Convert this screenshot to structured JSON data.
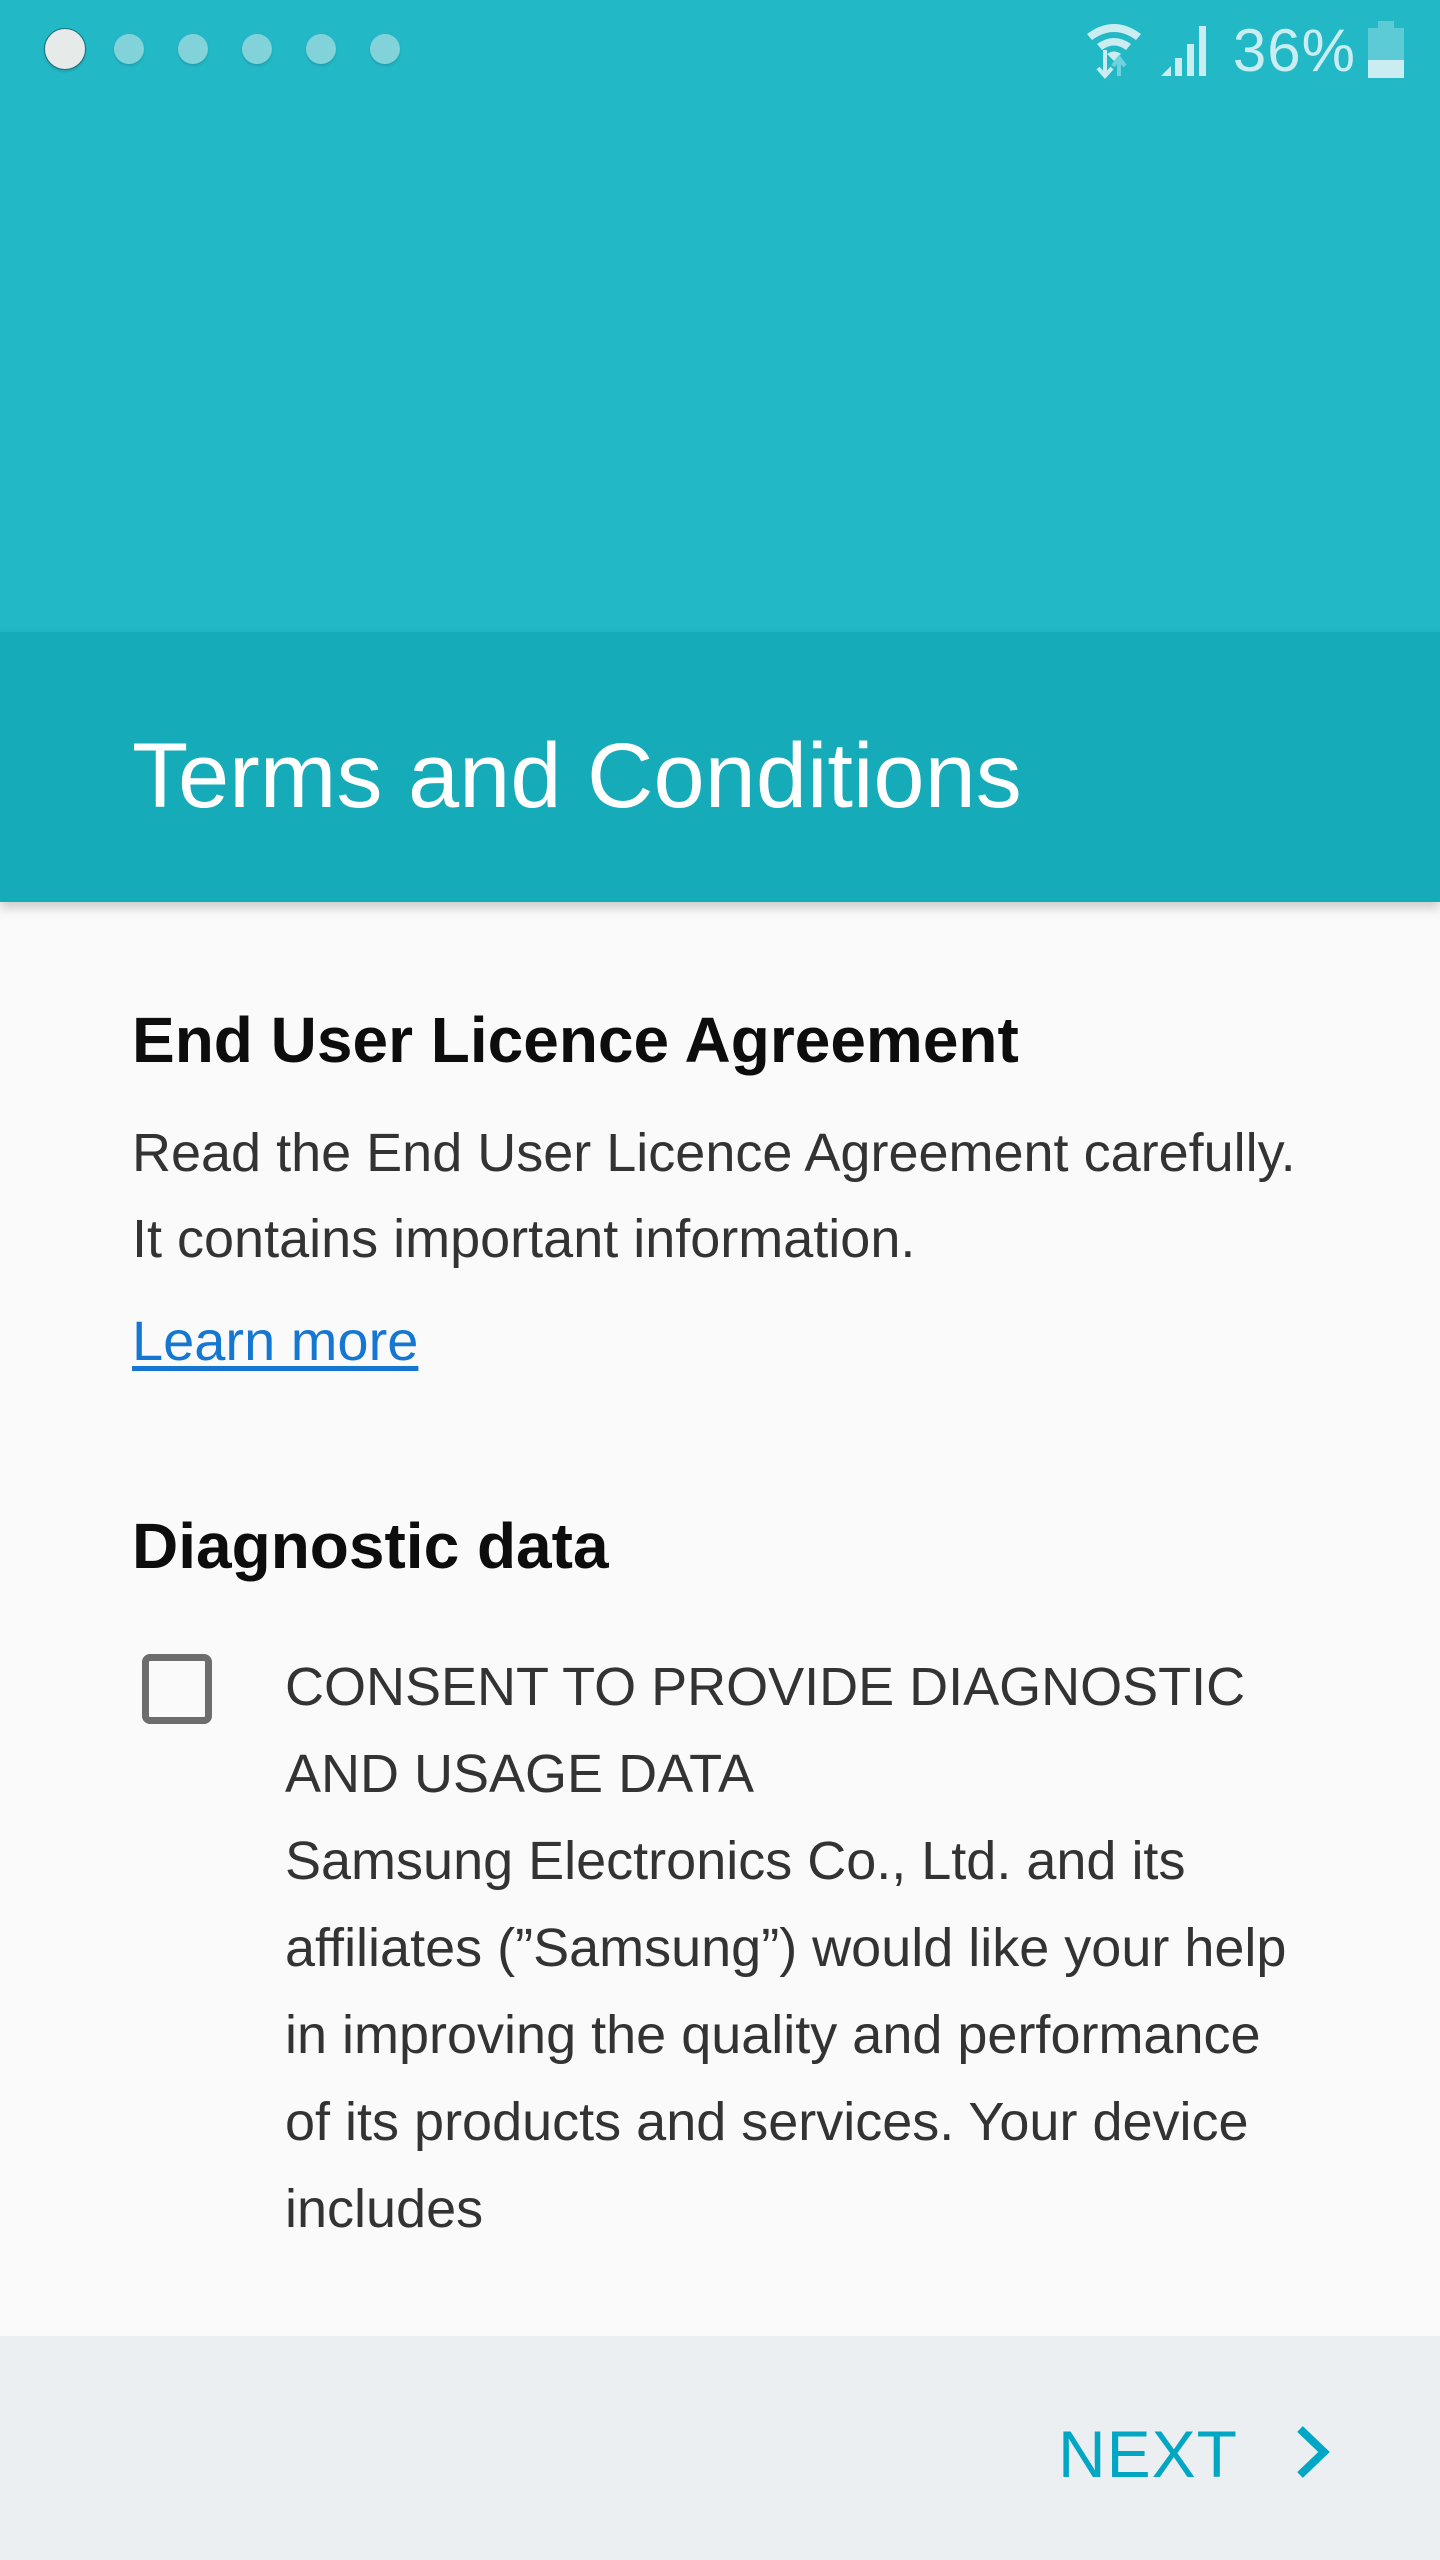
{
  "status_bar": {
    "page_indicator": {
      "total": 6,
      "active_index": 0
    },
    "icons": [
      "wifi-data-icon",
      "signal-strength-icon",
      "battery-icon"
    ],
    "battery_percent": "36%",
    "battery_level": 0.36
  },
  "header": {
    "title": "Terms and Conditions"
  },
  "eula": {
    "title": "End User Licence Agreement",
    "description": "Read the End User Licence Agreement carefully. It contains important information.",
    "learn_more_label": "Learn more"
  },
  "diagnostic": {
    "title": "Diagnostic data",
    "checkbox_checked": false,
    "consent_heading": "CONSENT TO PROVIDE DIAGNOSTIC AND USAGE DATA",
    "consent_body": "Samsung Electronics Co., Ltd. and its affiliates (”Samsung”) would like your help in improving the quality and performance of its products and services. Your device includes"
  },
  "footer": {
    "next_label": "NEXT"
  },
  "colors": {
    "top_background": "#22b8c6",
    "header_band": "#16abb8",
    "accent": "#00a7c4",
    "link": "#1577d2",
    "content_background": "#fafafa",
    "bottom_bar": "#ebeff2"
  }
}
